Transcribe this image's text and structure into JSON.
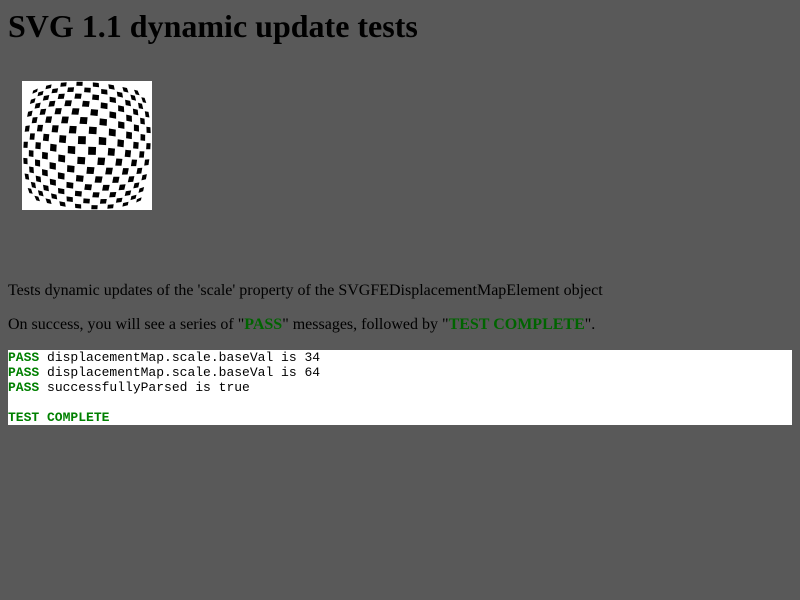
{
  "page": {
    "title": "SVG 1.1 dynamic update tests",
    "description": "Tests dynamic updates of the 'scale' property of the SVGFEDisplacementMapElement object",
    "success_pre": "On success, you will see a series of \"",
    "success_pass": "PASS",
    "success_mid": "\" messages, followed by \"",
    "success_complete": "TEST COMPLETE",
    "success_post": "\"."
  },
  "console": {
    "lines": [
      {
        "tag": "PASS",
        "text": " displacementMap.scale.baseVal is 34"
      },
      {
        "tag": "PASS",
        "text": " displacementMap.scale.baseVal is 64"
      },
      {
        "tag": "PASS",
        "text": " successfullyParsed is true"
      }
    ],
    "complete": "TEST COMPLETE"
  },
  "colors": {
    "background": "#595959",
    "pass": "#008000",
    "highlight": "#006400",
    "console_bg": "#ffffff"
  },
  "image": {
    "description_icon": "checkerboard-displacement-image",
    "scale": 64
  }
}
